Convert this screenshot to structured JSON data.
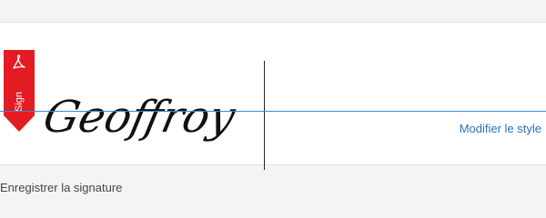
{
  "signature": {
    "tab_label": "Sign",
    "tab_icon": "acrobat-sign-icon",
    "tab_color": "#e31c23",
    "text": "Geoffroy",
    "baseline_color": "#3a8ad0",
    "change_style_label": "Modifier le style",
    "link_color": "#2d6fbf"
  },
  "footer": {
    "save_label": "Enregistrer la signature"
  }
}
